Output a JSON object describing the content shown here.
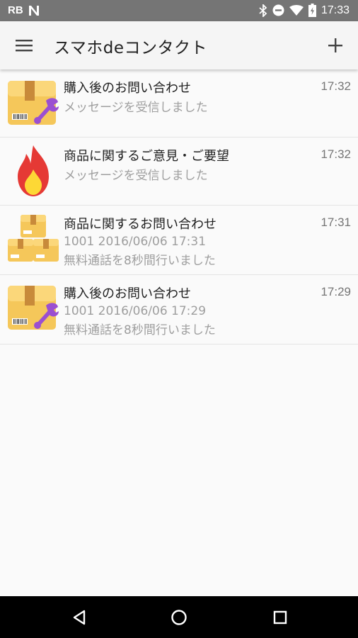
{
  "status_bar": {
    "carrier": "RB",
    "time": "17:33",
    "icons": [
      "notification-n-icon",
      "bluetooth-icon",
      "do-not-disturb-icon",
      "wifi-icon",
      "battery-icon"
    ],
    "background": "#757575"
  },
  "app_bar": {
    "title": "スマホdeコンタクト",
    "menu_icon": "hamburger-menu-icon",
    "add_icon": "plus-icon"
  },
  "threads": [
    {
      "icon": "package-wrench-icon",
      "title": "購入後のお問い合わせ",
      "time": "17:32",
      "lines": [
        "メッセージを受信しました"
      ]
    },
    {
      "icon": "flame-icon",
      "title": "商品に関するご意見・ご要望",
      "time": "17:32",
      "lines": [
        "メッセージを受信しました"
      ]
    },
    {
      "icon": "stacked-boxes-icon",
      "title": "商品に関するお問い合わせ",
      "time": "17:31",
      "lines": [
        "1001 2016/06/06 17:31",
        "無料通話を8秒間行いました"
      ]
    },
    {
      "icon": "package-wrench-icon",
      "title": "購入後のお問い合わせ",
      "time": "17:29",
      "lines": [
        "1001 2016/06/06 17:29",
        "無料通話を8秒間行いました"
      ]
    }
  ],
  "nav_bar": {
    "buttons": [
      "back-icon",
      "home-icon",
      "recents-icon"
    ]
  }
}
